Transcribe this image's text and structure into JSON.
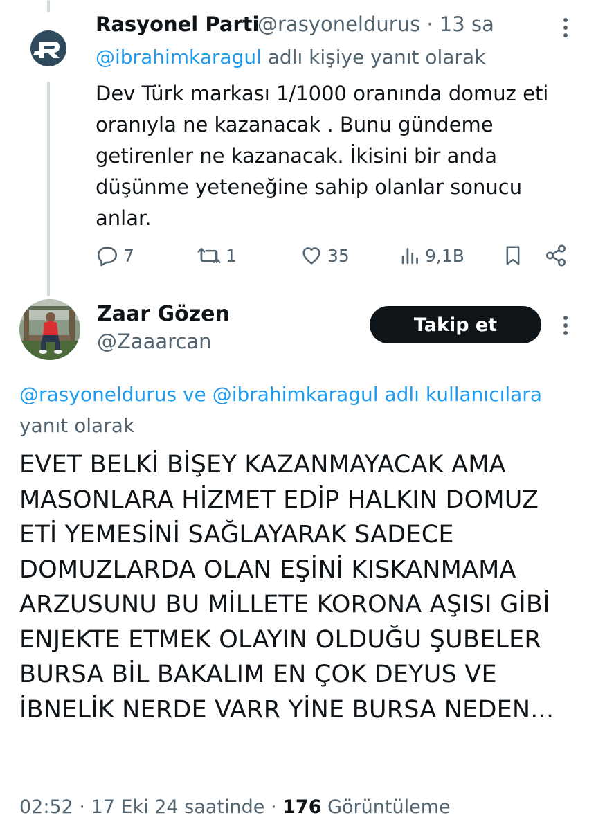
{
  "tweet1": {
    "display_name": "Rasyonel Parti",
    "handle": "@rasyoneldurus",
    "separator": "·",
    "time": "13 sa",
    "reply_mention": "@ibrahimkaragul",
    "reply_suffix": " adlı kişiye yanıt olarak",
    "text": "Dev Türk markası 1/1000 oranında domuz eti oranıyla ne kazanacak . Bunu gündeme getirenler ne kazanacak. İkisini bir anda düşünme yeteneğine sahip olanlar sonucu anlar.",
    "actions": {
      "replies": "7",
      "retweets": "1",
      "likes": "35",
      "views": "9,1B"
    }
  },
  "tweet2": {
    "display_name": "Zaar Gözen",
    "handle": "@Zaaarcan",
    "follow_label": "Takip et",
    "reply_mention_1": "@rasyoneldurus",
    "reply_and": " ve ",
    "reply_mention_2": "@ibrahimkaragul",
    "reply_suffix": " adlı kullanıcılara yanıt olarak",
    "text": "EVET BELKİ BİŞEY KAZANMAYACAK AMA MASONLARA HİZMET EDİP HALKIN DOMUZ ETİ YEMESİNİ SAĞLAYARAK SADECE DOMUZLARDA OLAN  EŞİNİ KISKANMAMA ARZUSUNU BU MİLLETE KORONA AŞISI GİBİ ENJEKTE ETMEK OLAYIN OLDUĞU ŞUBELER BURSA BİL BAKALIM EN ÇOK DEYUS VE İBNELİK NERDE VARR YİNE BURSA NEDEN...",
    "time": "02:52",
    "date": "17 Eki 24 saatinde",
    "separator": "·",
    "view_count": "176",
    "view_label": "Görüntüleme"
  },
  "icons": [
    "reply-icon",
    "retweet-icon",
    "like-icon",
    "views-icon",
    "bookmark-icon",
    "share-icon",
    "more-icon"
  ],
  "colors": {
    "link": "#1d9bf0",
    "secondary": "#536471",
    "primary_text": "#0f1419",
    "thread_line": "#cfd9de"
  }
}
